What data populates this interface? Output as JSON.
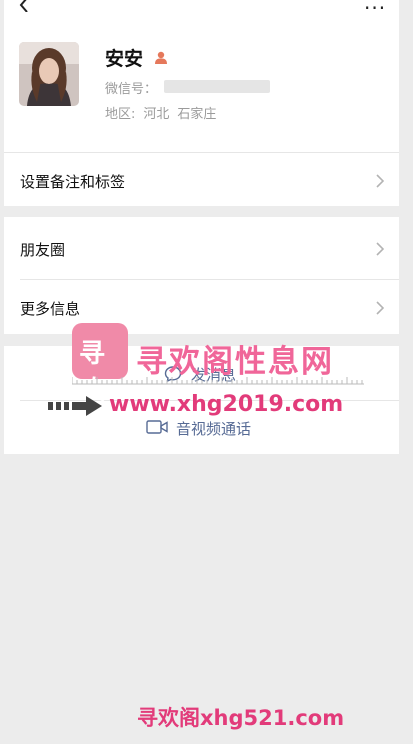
{
  "header": {
    "back_icon": "chevron-left-icon",
    "more_label": "···"
  },
  "profile": {
    "name": "安安",
    "gender_icon": "person-icon",
    "wechat_id_label": "微信号：",
    "region_label": "地区:",
    "region_province": "河北",
    "region_city": "石家庄"
  },
  "rows": {
    "remark_tags": "设置备注和标签",
    "moments": "朋友圈",
    "more_info": "更多信息"
  },
  "actions": {
    "send_message": "发消息",
    "video_call": "音视频通话"
  },
  "watermark": {
    "logo_text": "寻欢",
    "site_name": "寻欢阁性息网",
    "url": "www.xhg2019.com",
    "bottom_text": "寻欢阁xhg521.com"
  },
  "colors": {
    "action": "#576b95",
    "watermark": "#e23b7a",
    "background": "#ececec"
  }
}
